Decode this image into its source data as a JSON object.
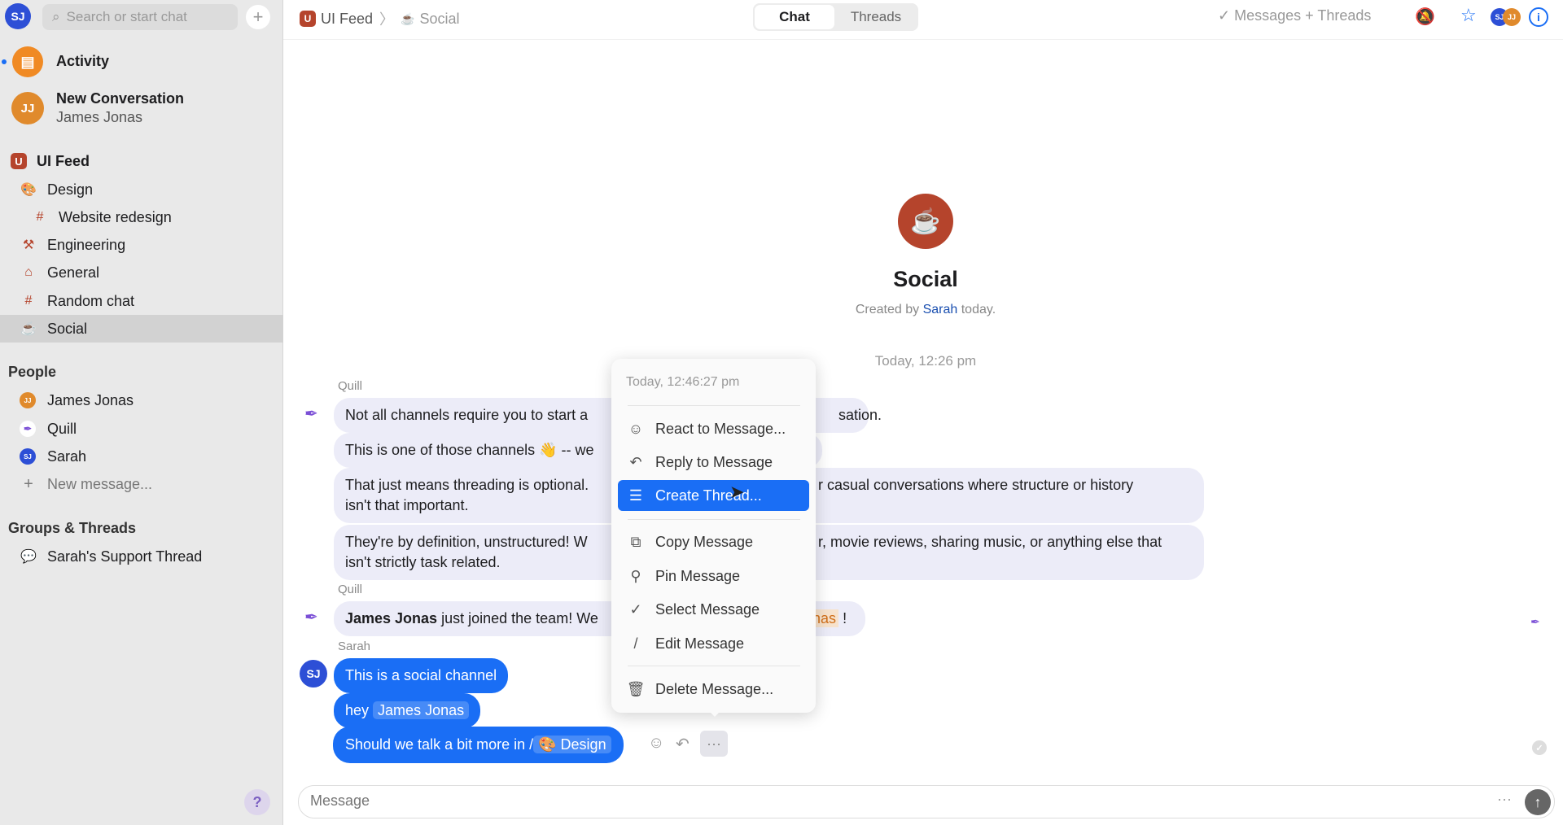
{
  "sidebar": {
    "user_initials": "SJ",
    "search_placeholder": "Search or start chat",
    "activity": "Activity",
    "new_conversation": {
      "title": "New Conversation",
      "subtitle": "James Jonas",
      "initials": "JJ"
    },
    "workspace": {
      "badge": "U",
      "name": "UI Feed"
    },
    "channels": [
      {
        "label": "Design"
      },
      {
        "label": "Website redesign"
      },
      {
        "label": "Engineering"
      },
      {
        "label": "General"
      },
      {
        "label": "Random chat"
      },
      {
        "label": "Social"
      }
    ],
    "people_title": "People",
    "people": [
      {
        "label": "James Jonas",
        "initials": "JJ"
      },
      {
        "label": "Quill"
      },
      {
        "label": "Sarah",
        "initials": "SJ"
      }
    ],
    "new_message": "New message...",
    "groups_title": "Groups & Threads",
    "groups": [
      {
        "label": "Sarah's Support Thread"
      }
    ],
    "help": "?"
  },
  "header": {
    "breadcrumb": [
      "UI Feed",
      "Social"
    ],
    "tabs": [
      "Chat",
      "Threads"
    ],
    "active_tab": "Chat",
    "filter": "Messages + Threads",
    "avatars": [
      "SJ",
      "JJ"
    ]
  },
  "channel": {
    "name": "Social",
    "created_prefix": "Created by",
    "creator": "Sarah",
    "created_suffix": "today.",
    "date": "Today, 12:26 pm"
  },
  "messages": {
    "quill1": "Quill",
    "m1": "Not all channels require you to start a new thread for every conversation.",
    "m1_visible_left": "Not all channels require you to start a",
    "m1_visible_right": "sation.",
    "m2_left": "This is one of those channels 👋 -- we",
    "m3_left": "That just means threading is optional.",
    "m3_right": "r casual conversations where structure or history",
    "m3_line2": "isn't that important.",
    "m4_left": "They're by definition, unstructured! W",
    "m4_right": "r, movie reviews, sharing music, or anything else that",
    "m4_line2": "isn't strictly task related.",
    "quill2": "Quill",
    "m5_bold": "James Jonas",
    "m5_left": "just joined the team! We",
    "m5_mention": "onas",
    "m5_end": "!",
    "sarah": "Sarah",
    "sarah_initials": "SJ",
    "s1": "This is a social channel",
    "s2_prefix": "hey",
    "s2_mention": "James Jonas",
    "s3_prefix": "Should we talk a bit more in /",
    "s3_channel": "Design"
  },
  "context_menu": {
    "timestamp": "Today, 12:46:27 pm",
    "items": [
      "React to Message...",
      "Reply to Message",
      "Create Thread...",
      "Copy Message",
      "Pin Message",
      "Select Message",
      "Edit Message",
      "Delete Message..."
    ],
    "highlighted": "Create Thread..."
  },
  "composer": {
    "placeholder": "Message"
  },
  "colors": {
    "accent": "#1a6ef5",
    "social": "#b5442c",
    "bubble": "#ececf8"
  }
}
